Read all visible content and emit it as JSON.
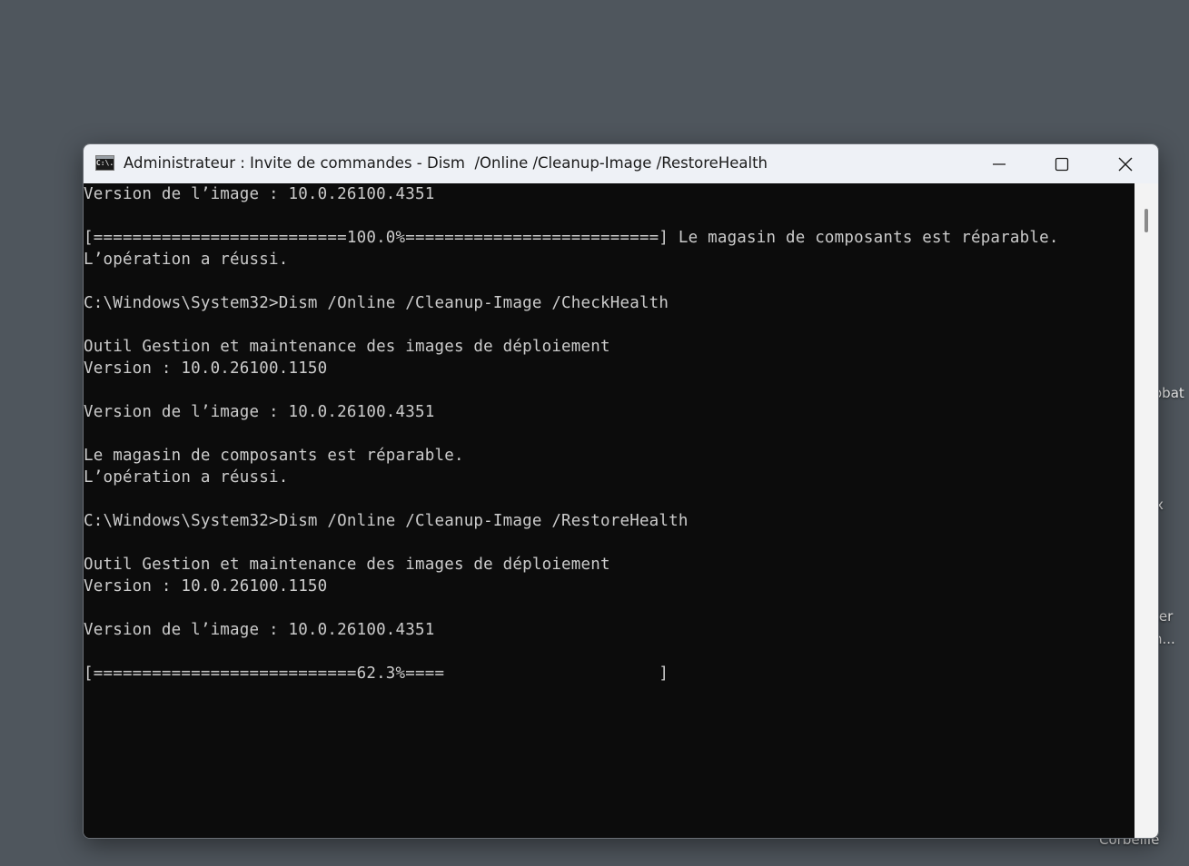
{
  "desktop": {
    "labels": [
      "obat",
      "x",
      "ter",
      "n...",
      "Corbeille"
    ]
  },
  "window": {
    "title": "Administrateur : Invite de commandes - Dism  /Online /Cleanup-Image /RestoreHealth",
    "icon": "console-app-icon",
    "icon_text": "C:\\.",
    "controls": {
      "minimize": "minimize-icon",
      "maximize": "maximize-icon",
      "close": "close-icon"
    }
  },
  "console": {
    "lines": [
      "Version de l’image : 10.0.26100.4351",
      "",
      "[==========================100.0%==========================] Le magasin de composants est réparable.",
      "L’opération a réussi.",
      "",
      "C:\\Windows\\System32>Dism /Online /Cleanup-Image /CheckHealth",
      "",
      "Outil Gestion et maintenance des images de déploiement",
      "Version : 10.0.26100.1150",
      "",
      "Version de l’image : 10.0.26100.4351",
      "",
      "Le magasin de composants est réparable.",
      "L’opération a réussi.",
      "",
      "C:\\Windows\\System32>Dism /Online /Cleanup-Image /RestoreHealth",
      "",
      "Outil Gestion et maintenance des images de déploiement",
      "Version : 10.0.26100.1150",
      "",
      "Version de l’image : 10.0.26100.4351",
      "",
      "[===========================62.3%====                      ]"
    ],
    "progress_percent": 62.3
  },
  "colors": {
    "console_bg": "#0c0c0c",
    "console_fg": "#cccccc",
    "titlebar_bg": "#eef1f6",
    "desktop_bg": "#4f565d"
  }
}
